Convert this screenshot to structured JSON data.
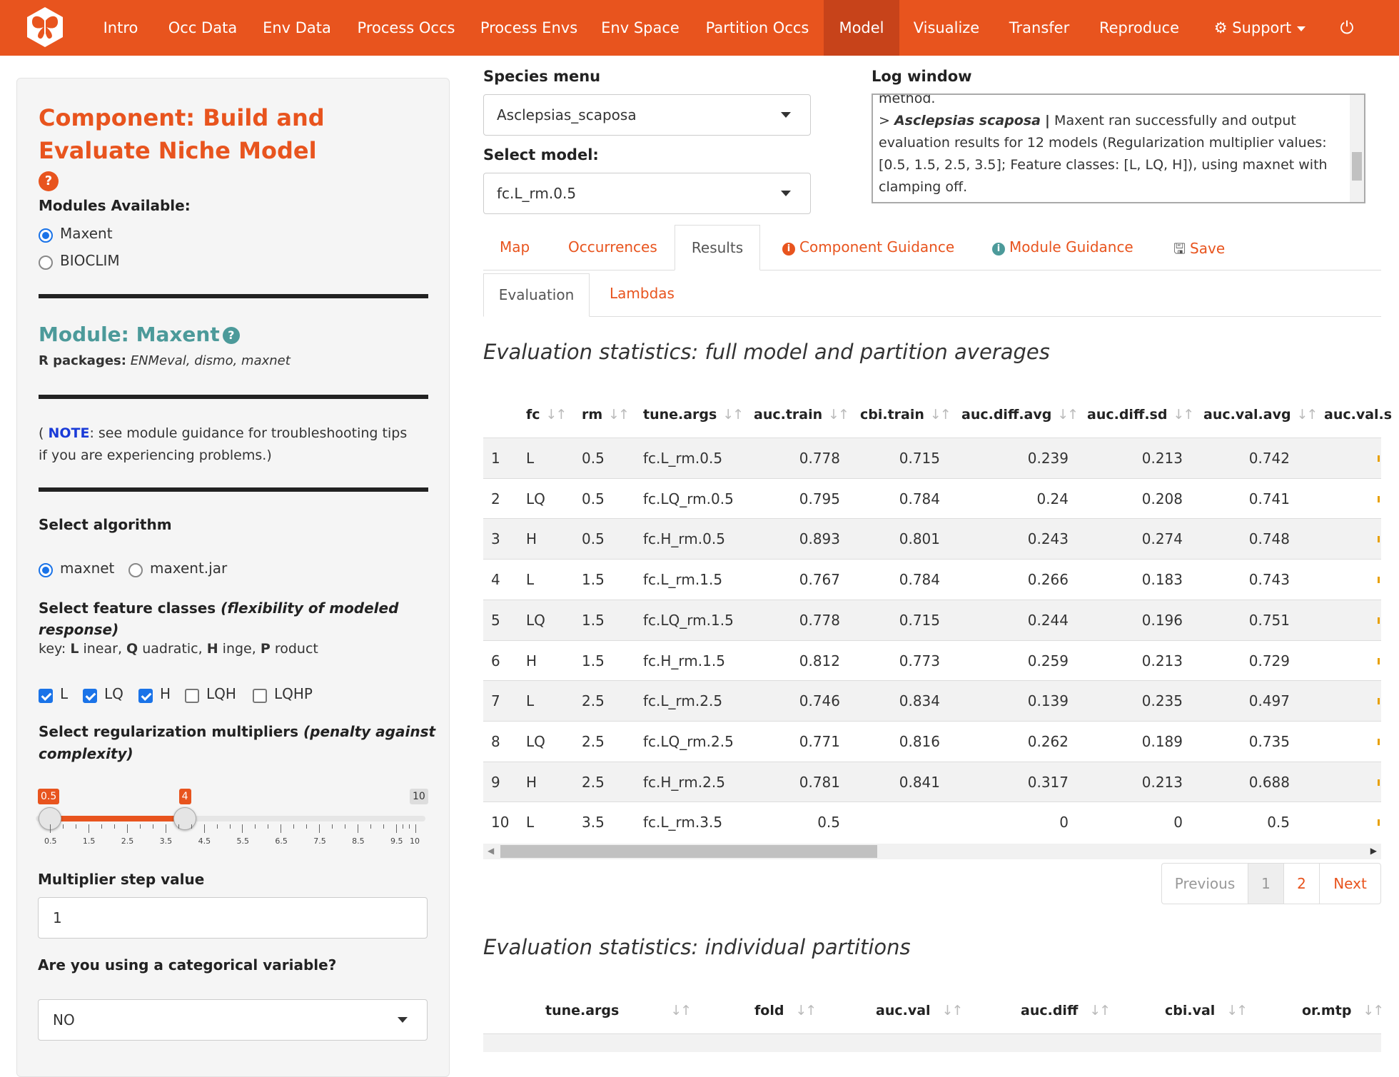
{
  "nav": {
    "items": [
      "Intro",
      "Occ Data",
      "Env Data",
      "Process Occs",
      "Process Envs",
      "Env Space",
      "Partition Occs",
      "Model",
      "Visualize",
      "Transfer",
      "Reproduce"
    ],
    "support": "Support",
    "active": "Model"
  },
  "sidebar": {
    "component_title": "Component: Build and Evaluate Niche Model",
    "modules_label": "Modules Available:",
    "modules": [
      "Maxent",
      "BIOCLIM"
    ],
    "module_title": "Module: Maxent",
    "r_packages_label": "R packages:",
    "r_packages": "ENMeval, dismo, maxnet",
    "note_open": "(",
    "note_word": "NOTE",
    "note_text1": ": see module guidance for troubleshooting tips",
    "note_text2": "if you are experiencing problems.)",
    "algorithm_label": "Select algorithm",
    "algorithms": [
      "maxnet",
      "maxent.jar"
    ],
    "feature_label": "Select feature classes",
    "feature_label_em": "(flexibility of modeled",
    "feature_label_em2": "response)",
    "key_text": [
      "key:",
      "L",
      "inear,",
      "Q",
      "uadratic,",
      "H",
      "inge,",
      "P",
      "roduct"
    ],
    "feature_classes": [
      {
        "label": "L",
        "checked": true
      },
      {
        "label": "LQ",
        "checked": true
      },
      {
        "label": "H",
        "checked": true
      },
      {
        "label": "LQH",
        "checked": false
      },
      {
        "label": "LQHP",
        "checked": false
      }
    ],
    "reg_label": "Select regularization multipliers",
    "reg_label_em": "(penalty against",
    "reg_label_em2": "complexity)",
    "slider": {
      "min": 0.5,
      "max": 10,
      "low": 0.5,
      "high": 4,
      "min_label": "0.5",
      "high_label": "4",
      "max_label": "10",
      "ticks": [
        "0.5",
        "1.5",
        "2.5",
        "3.5",
        "4.5",
        "5.5",
        "6.5",
        "7.5",
        "8.5",
        "9.5",
        "10"
      ]
    },
    "step_label": "Multiplier step value",
    "step_value": "1",
    "categorical_label": "Are you using a categorical variable?",
    "categorical_value": "NO"
  },
  "main": {
    "species_label": "Species menu",
    "species_value": "Asclepsias_scaposa",
    "model_label": "Select model:",
    "model_value": "fc.L_rm.0.5",
    "log_label": "Log window",
    "log_top": "method.",
    "log_prefix": ">",
    "log_species": "Asclepsias scaposa",
    "log_sep": "|",
    "log_msg": "Maxent ran successfully and output evaluation results for 12 models (Regularization multiplier values: [0.5, 1.5, 2.5, 3.5]; Feature classes: [L, LQ, H]), using maxnet with clamping off.",
    "tabs": [
      "Map",
      "Occurrences",
      "Results",
      "Component Guidance",
      "Module Guidance",
      "Save"
    ],
    "subtabs": [
      "Evaluation",
      "Lambdas"
    ],
    "sec1_title": "Evaluation statistics: full model and partition averages",
    "sec2_title": "Evaluation statistics: individual partitions",
    "table1": {
      "headers": [
        "fc",
        "rm",
        "tune.args",
        "auc.train",
        "cbi.train",
        "auc.diff.avg",
        "auc.diff.sd",
        "auc.val.avg",
        "auc.val.s"
      ],
      "rows": [
        [
          "1",
          "L",
          "0.5",
          "fc.L_rm.0.5",
          "0.778",
          "0.715",
          "0.239",
          "0.213",
          "0.742"
        ],
        [
          "2",
          "LQ",
          "0.5",
          "fc.LQ_rm.0.5",
          "0.795",
          "0.784",
          "0.24",
          "0.208",
          "0.741"
        ],
        [
          "3",
          "H",
          "0.5",
          "fc.H_rm.0.5",
          "0.893",
          "0.801",
          "0.243",
          "0.274",
          "0.748"
        ],
        [
          "4",
          "L",
          "1.5",
          "fc.L_rm.1.5",
          "0.767",
          "0.784",
          "0.266",
          "0.183",
          "0.743"
        ],
        [
          "5",
          "LQ",
          "1.5",
          "fc.LQ_rm.1.5",
          "0.778",
          "0.715",
          "0.244",
          "0.196",
          "0.751"
        ],
        [
          "6",
          "H",
          "1.5",
          "fc.H_rm.1.5",
          "0.812",
          "0.773",
          "0.259",
          "0.213",
          "0.729"
        ],
        [
          "7",
          "L",
          "2.5",
          "fc.L_rm.2.5",
          "0.746",
          "0.834",
          "0.139",
          "0.235",
          "0.497"
        ],
        [
          "8",
          "LQ",
          "2.5",
          "fc.LQ_rm.2.5",
          "0.771",
          "0.816",
          "0.262",
          "0.189",
          "0.735"
        ],
        [
          "9",
          "H",
          "2.5",
          "fc.H_rm.2.5",
          "0.781",
          "0.841",
          "0.317",
          "0.213",
          "0.688"
        ],
        [
          "10",
          "L",
          "3.5",
          "fc.L_rm.3.5",
          "0.5",
          "",
          "0",
          "0",
          "0.5"
        ]
      ]
    },
    "pagination": {
      "previous": "Previous",
      "pages": [
        "1",
        "2"
      ],
      "next": "Next"
    },
    "table2": {
      "headers": [
        "tune.args",
        "fold",
        "auc.val",
        "auc.diff",
        "cbi.val",
        "or.mtp"
      ]
    }
  },
  "colors": {
    "brand": "#e8541e",
    "teal": "#4c9a9a",
    "link_blue": "#1a73e8"
  }
}
